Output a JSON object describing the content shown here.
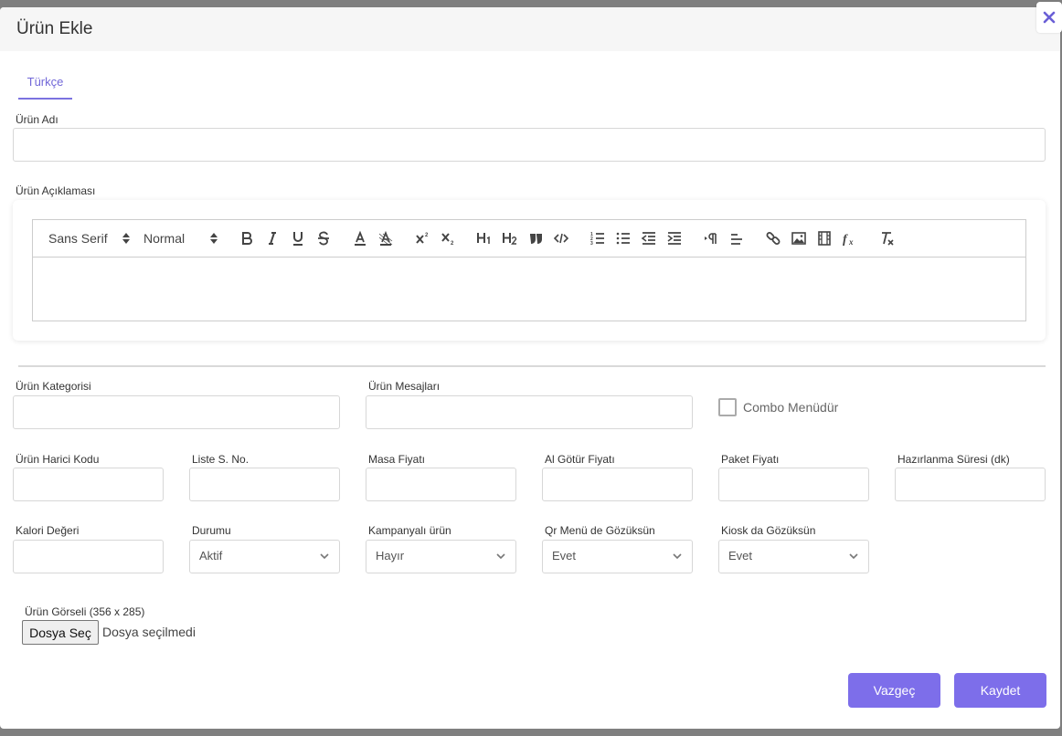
{
  "modal": {
    "title": "Ürün Ekle",
    "close_icon": "close-icon"
  },
  "tabs": [
    "Türkçe"
  ],
  "fields": {
    "product_name_label": "Ürün Adı",
    "description_label": "Ürün Açıklaması",
    "category_label": "Ürün Kategorisi",
    "messages_label": "Ürün Mesajları",
    "combo_menu_label": "Combo Menüdür",
    "external_code_label": "Ürün Harici Kodu",
    "list_order_label": "Liste S. No.",
    "table_price_label": "Masa Fiyatı",
    "takeaway_price_label": "Al Götür Fiyatı",
    "package_price_label": "Paket Fiyatı",
    "prep_time_label": "Hazırlanma Süresi (dk)",
    "calorie_label": "Kalori Değeri",
    "status_label": "Durumu",
    "status_value": "Aktif",
    "campaign_label": "Kampanyalı ürün",
    "campaign_value": "Hayır",
    "qr_menu_label": "Qr Menü de Gözüksün",
    "qr_menu_value": "Evet",
    "kiosk_label": "Kiosk da Gözüksün",
    "kiosk_value": "Evet",
    "image_label": "Ürün Görseli (356 x 285)",
    "file_button": "Dosya Seç",
    "file_status": "Dosya seçilmedi"
  },
  "editor": {
    "font_picker": "Sans Serif",
    "size_picker": "Normal"
  },
  "buttons": {
    "cancel": "Vazgeç",
    "save": "Kaydet"
  },
  "colors": {
    "accent": "#7d6eea",
    "tab_text": "#7268d8"
  }
}
